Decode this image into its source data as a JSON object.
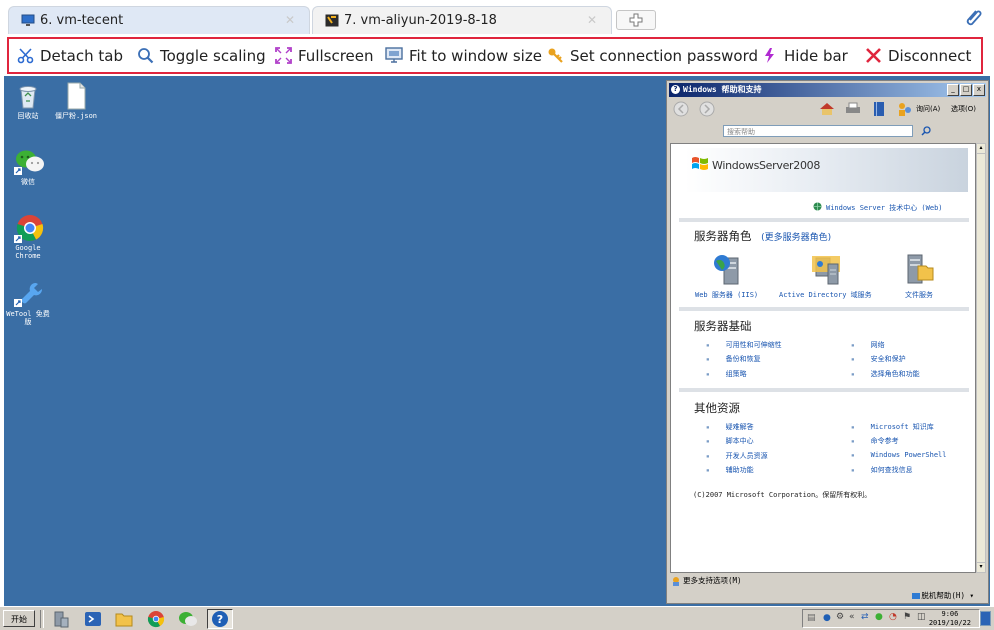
{
  "tabs": [
    {
      "label": "6. vm-tecent",
      "icon": "monitor-icon",
      "active": true
    },
    {
      "label": "7. vm-aliyun-2019-8-18",
      "icon": "terminal-icon",
      "active": false
    }
  ],
  "toolbar": {
    "detach": "Detach tab",
    "toggle_scaling": "Toggle scaling",
    "fullscreen": "Fullscreen",
    "fit": "Fit to window size",
    "password": "Set connection password",
    "hide_bar": "Hide bar",
    "disconnect": "Disconnect"
  },
  "desktop": {
    "background": "#3a6ea5",
    "icons": [
      {
        "label": "回收站",
        "icon": "recycle-bin-icon"
      },
      {
        "label": "僵尸粉.json",
        "icon": "file-icon"
      },
      {
        "label": "微信",
        "icon": "wechat-icon"
      },
      {
        "label": "Google Chrome",
        "icon": "chrome-icon"
      },
      {
        "label": "WeTool 免费版",
        "icon": "wetool-icon"
      }
    ]
  },
  "help_window": {
    "title": "Windows 帮助和支持",
    "nav": {
      "ask": "询问(A)",
      "options": "选项(O)"
    },
    "search_placeholder": "搜索帮助",
    "banner_logo": "WindowsServer2008",
    "tech_center": "Windows Server 技术中心 (Web)",
    "roles_title": "服务器角色",
    "roles_more": "(更多服务器角色)",
    "roles": [
      {
        "label": "Web 服务器 (IIS)",
        "icon": "web-server-icon"
      },
      {
        "label": "Active Directory 域服务",
        "icon": "active-directory-icon"
      },
      {
        "label": "文件服务",
        "icon": "file-services-icon"
      }
    ],
    "basics_title": "服务器基础",
    "basics_left": [
      "可用性和可伸缩性",
      "备份和恢复",
      "组策略"
    ],
    "basics_right": [
      "网络",
      "安全和保护",
      "选择角色和功能"
    ],
    "other_title": "其他资源",
    "other_left": [
      "疑难解答",
      "脚本中心",
      "开发人员资源",
      "辅助功能"
    ],
    "other_right": [
      "Microsoft 知识库",
      "命令参考",
      "Windows PowerShell",
      "如何查找信息"
    ],
    "copyright": "(C)2007 Microsoft Corporation。保留所有权利。",
    "more_support": "更多支持选项(M)",
    "offline_help": "脱机帮助(H)"
  },
  "taskbar": {
    "start": "开始",
    "clock_time": "9:06",
    "clock_date": "2019/10/22"
  },
  "colors": {
    "accent_border": "#e0253d",
    "link": "#1a56b0",
    "tab_active": "#dfe8f5"
  }
}
